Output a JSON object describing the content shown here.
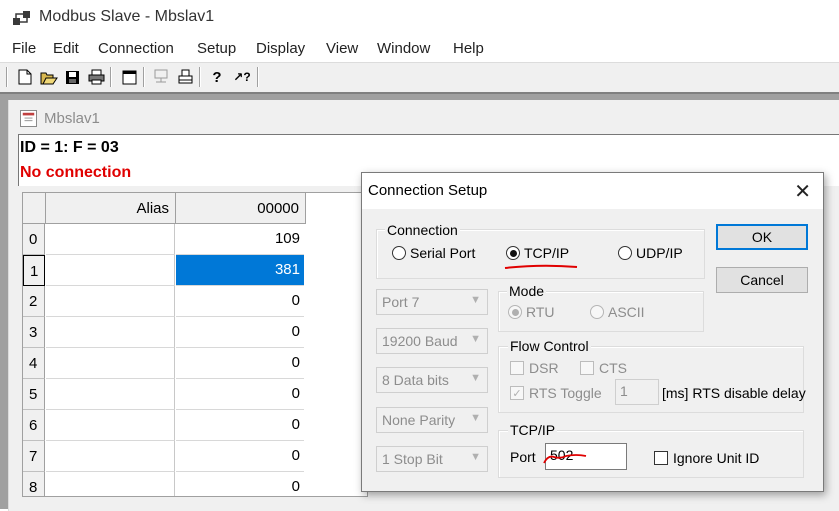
{
  "app": {
    "title": "Modbus Slave - Mbslav1"
  },
  "menu": [
    "File",
    "Edit",
    "Connection",
    "Setup",
    "Display",
    "View",
    "Window",
    "Help"
  ],
  "toolbar": {
    "buttons": [
      "new-document-icon",
      "open-folder-icon",
      "save-disk-icon",
      "print-icon",
      "window-icon",
      "network-icon",
      "printer-setup-icon",
      "help-icon",
      "context-help-icon"
    ],
    "help_glyph": "?",
    "context_help_glyph": "↗?"
  },
  "child_window": {
    "title": "Mbslav1",
    "id_line": "ID = 1: F = 03",
    "status": "No connection",
    "status_color": "#e00000",
    "grid": {
      "alias_header": "Alias",
      "address_header": "00000",
      "rows": [
        {
          "num": "0",
          "value": "109"
        },
        {
          "num": "1",
          "value": "381",
          "selected": true
        },
        {
          "num": "2",
          "value": "0"
        },
        {
          "num": "3",
          "value": "0"
        },
        {
          "num": "4",
          "value": "0"
        },
        {
          "num": "5",
          "value": "0"
        },
        {
          "num": "6",
          "value": "0"
        },
        {
          "num": "7",
          "value": "0"
        },
        {
          "num": "8",
          "value": "0"
        }
      ]
    }
  },
  "dialog": {
    "title": "Connection Setup",
    "close_glyph": "✕",
    "connection_group": "Connection",
    "serial_port": "Serial Port",
    "tcp_ip": "TCP/IP",
    "udp_ip": "UDP/IP",
    "selected_connection": "TCP/IP",
    "ok_label": "OK",
    "cancel_label": "Cancel",
    "port_combo": "Port 7",
    "baud_combo": "19200 Baud",
    "databits_combo": "8 Data bits",
    "parity_combo": "None Parity",
    "stopbit_combo": "1 Stop Bit",
    "mode_group": "Mode",
    "mode_rtu": "RTU",
    "mode_ascii": "ASCII",
    "flow_group": "Flow Control",
    "dsr": "DSR",
    "cts": "CTS",
    "rts_toggle": "RTS Toggle",
    "rts_value": "1",
    "rts_suffix": "[ms] RTS disable delay",
    "tcpip_group": "TCP/IP",
    "port_label": "Port",
    "port_value": "502",
    "ignore_unit_id": "Ignore Unit ID",
    "annotation_color": "#e00000"
  }
}
